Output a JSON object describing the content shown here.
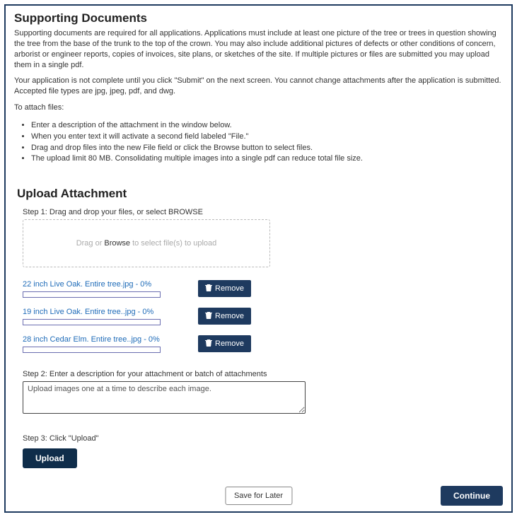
{
  "title": "Supporting Documents",
  "intro_p1": "Supporting documents are required for all applications. Applications must include at least one picture of the tree or trees in question showing the tree from the base of the trunk to the top of the crown. You may also include additional pictures of defects or other conditions of concern, arborist or engineer reports, copies of invoices, site plans, or sketches of the site. If multiple pictures or files are submitted you may upload them in a single pdf.",
  "intro_p2": "Your application is not complete until you click \"Submit\" on the next screen. You cannot change attachments after the application is submitted. Accepted file types are jpg, jpeg, pdf, and dwg.",
  "intro_p3": "To attach files:",
  "instructions": [
    "Enter a description of the attachment in the window below.",
    "When you enter text it will activate a second field labeled \"File.\"",
    "Drag and drop files into the new File field or click the Browse button to select files.",
    "The upload limit 80 MB. Consolidating multiple images into a single pdf can reduce total file size."
  ],
  "upload_heading": "Upload Attachment",
  "step1_label": "Step 1: Drag and drop your files, or select BROWSE",
  "dropzone_pre": "Drag or",
  "dropzone_browse": "Browse",
  "dropzone_post": "to select file(s) to upload",
  "files": [
    {
      "name": "22 inch Live Oak. Entire tree.jpg - 0%"
    },
    {
      "name": "19 inch Live Oak. Entire tree..jpg - 0%"
    },
    {
      "name": "28 inch Cedar Elm. Entire tree..jpg - 0%"
    }
  ],
  "remove_label": "Remove",
  "step2_label": "Step 2: Enter a description for your attachment or batch of attachments",
  "desc_value": "Upload images one at a time to describe each image.",
  "step3_label": "Step 3: Click \"Upload\"",
  "upload_btn": "Upload",
  "save_later": "Save for Later",
  "continue": "Continue"
}
